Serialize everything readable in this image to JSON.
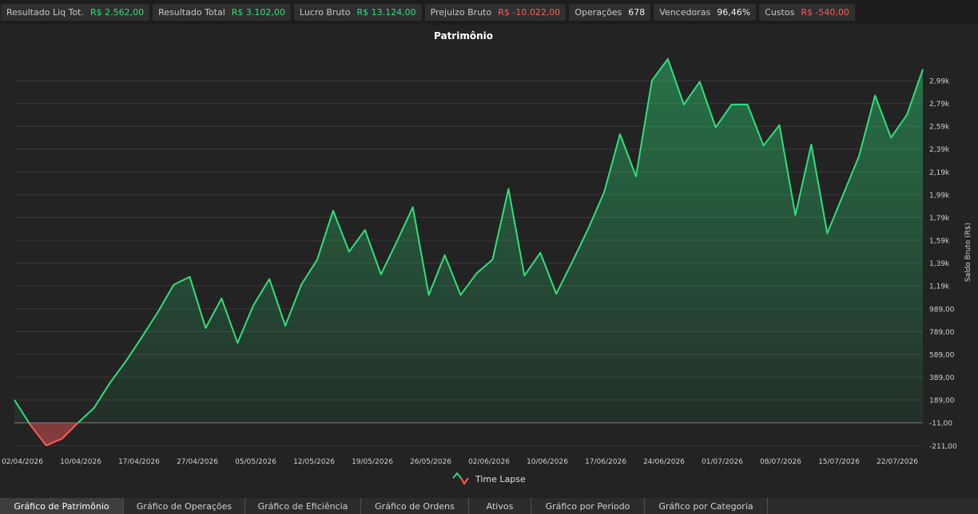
{
  "stats": [
    {
      "label": "Resultado Liq Tot.",
      "value": "R$ 2.562,00",
      "tone": "pos"
    },
    {
      "label": "Resultado Total",
      "value": "R$ 3.102,00",
      "tone": "pos"
    },
    {
      "label": "Lucro Bruto",
      "value": "R$ 13.124,00",
      "tone": "pos"
    },
    {
      "label": "Prejuizo Bruto",
      "value": "R$ -10.022,00",
      "tone": "neg"
    },
    {
      "label": "Operações",
      "value": "678",
      "tone": "neu"
    },
    {
      "label": "Vencedoras",
      "value": "96,46%",
      "tone": "neu"
    },
    {
      "label": "Custos",
      "value": "R$ -540,00",
      "tone": "neg"
    }
  ],
  "chart_data": {
    "type": "area",
    "title": "Patrimônio",
    "ylabel": "Saldo Bruto (R$)",
    "xlabel": "",
    "ylim": [
      -230,
      3200
    ],
    "yticks": [
      -211,
      -11,
      189,
      389,
      589,
      789,
      989,
      1190,
      1390,
      1590,
      1790,
      1990,
      2190,
      2390,
      2590,
      2790,
      2990
    ],
    "ytick_labels": [
      "-211,00",
      "-11,00",
      "189,00",
      "389,00",
      "589,00",
      "789,00",
      "989,00",
      "1,19k",
      "1,39k",
      "1,59k",
      "1,79k",
      "1,99k",
      "2,19k",
      "2,39k",
      "2,59k",
      "2,79k",
      "2,99k"
    ],
    "xtick_labels": [
      "02/04/2026",
      "10/04/2026",
      "17/04/2026",
      "27/04/2026",
      "05/05/2026",
      "12/05/2026",
      "19/05/2026",
      "26/05/2026",
      "02/06/2026",
      "10/06/2026",
      "17/06/2026",
      "24/06/2026",
      "01/07/2026",
      "08/07/2026",
      "15/07/2026",
      "22/07/2026"
    ],
    "baseline": -11,
    "grid": true,
    "legend_position": "bottom",
    "series": [
      {
        "name": "Time Lapse",
        "color_up": "#2ee07c",
        "color_down": "#ff5a5a",
        "values": [
          190,
          -30,
          -210,
          -150,
          -10,
          120,
          340,
          530,
          740,
          960,
          1200,
          1270,
          820,
          1080,
          690,
          1020,
          1250,
          840,
          1200,
          1420,
          1850,
          1490,
          1680,
          1290,
          1580,
          1880,
          1110,
          1460,
          1110,
          1300,
          1420,
          2040,
          1280,
          1480,
          1120,
          1400,
          1690,
          2010,
          2520,
          2150,
          2990,
          3180,
          2780,
          2980,
          2580,
          2780,
          2780,
          2420,
          2600,
          1810,
          2430,
          1650,
          1990,
          2330,
          2860,
          2490,
          2690,
          3090
        ]
      }
    ]
  },
  "legend": {
    "label": "Time Lapse"
  },
  "tabs": [
    {
      "label": "Gráfico de Patrimônio",
      "active": true
    },
    {
      "label": "Gráfico de Operações",
      "active": false
    },
    {
      "label": "Gráfico de Eficiência",
      "active": false
    },
    {
      "label": "Gráfico de Ordens",
      "active": false
    },
    {
      "label": "Ativos",
      "active": false
    },
    {
      "label": "Gráfico por Periodo",
      "active": false
    },
    {
      "label": "Gráfico por Categoria",
      "active": false
    }
  ],
  "colors": {
    "positive": "#2ee07c",
    "negative": "#ff5a5a",
    "background": "#232323",
    "grid": "#3a3a3a"
  }
}
